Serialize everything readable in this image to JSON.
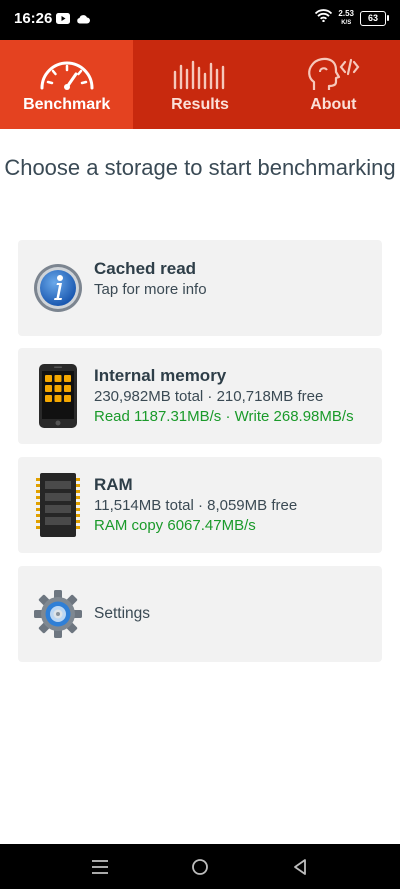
{
  "status": {
    "time": "16:26",
    "net_speed_value": "2.53",
    "net_speed_unit": "K/S",
    "battery": "63"
  },
  "tabs": [
    {
      "label": "Benchmark",
      "icon": "speedometer-icon",
      "active": true
    },
    {
      "label": "Results",
      "icon": "bars-chart-icon",
      "active": false
    },
    {
      "label": "About",
      "icon": "head-code-icon",
      "active": false
    }
  ],
  "heading": "Choose a storage to start benchmarking",
  "cards": {
    "cached": {
      "title": "Cached read",
      "subtitle": "Tap for more info",
      "icon": "info-icon"
    },
    "internal": {
      "title": "Internal memory",
      "detail": "230,982MB total · 210,718MB free",
      "speed": "Read 1187.31MB/s · Write 268.98MB/s",
      "icon": "phone-icon"
    },
    "ram": {
      "title": "RAM",
      "detail": "11,514MB total · 8,059MB free",
      "speed": "RAM copy 6067.47MB/s",
      "icon": "ram-chip-icon"
    },
    "settings": {
      "label": "Settings",
      "icon": "gear-icon"
    }
  },
  "colors": {
    "tab_bar": "#c8290e",
    "tab_active": "#e44220",
    "speed_text": "#1a9a2a",
    "card_bg": "#f2f2f2"
  }
}
